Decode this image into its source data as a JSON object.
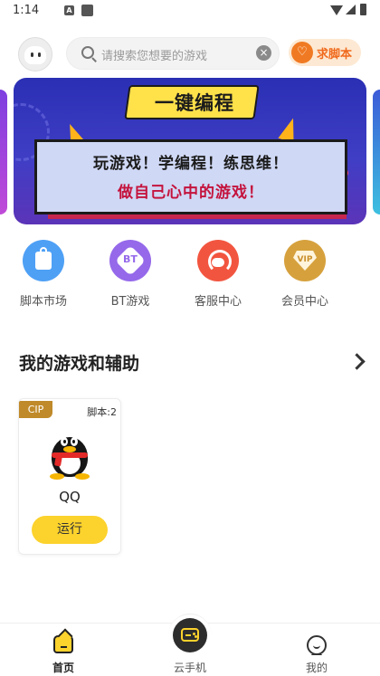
{
  "status_bar": {
    "time": "1:14",
    "notif_icon_letter": "A"
  },
  "header": {
    "search_placeholder": "请搜索您想要的游戏",
    "request_script_label": "求脚本"
  },
  "banner": {
    "title": "一键编程",
    "line1": "玩游戏！学编程！练思维！",
    "line2": "做自己心中的游戏！"
  },
  "quick_entries": [
    {
      "label": "脚本市场",
      "icon": "shopping-bag-icon"
    },
    {
      "label": "BT游戏",
      "icon": "bt-badge-icon",
      "icon_text": "BT"
    },
    {
      "label": "客服中心",
      "icon": "headset-icon"
    },
    {
      "label": "会员中心",
      "icon": "vip-diamond-icon",
      "icon_text": "VIP"
    }
  ],
  "section": {
    "title": "我的游戏和辅助"
  },
  "games": [
    {
      "badge": "CIP",
      "script_count": "脚本:2",
      "name": "QQ",
      "action": "运行"
    }
  ],
  "bottom_nav": [
    {
      "label": "首页",
      "active": true
    },
    {
      "label": "云手机",
      "active": false
    },
    {
      "label": "我的",
      "active": false
    }
  ],
  "colors": {
    "accent_yellow": "#fcd22c",
    "accent_orange": "#f07a23",
    "badge_gold": "#c08a2a"
  }
}
